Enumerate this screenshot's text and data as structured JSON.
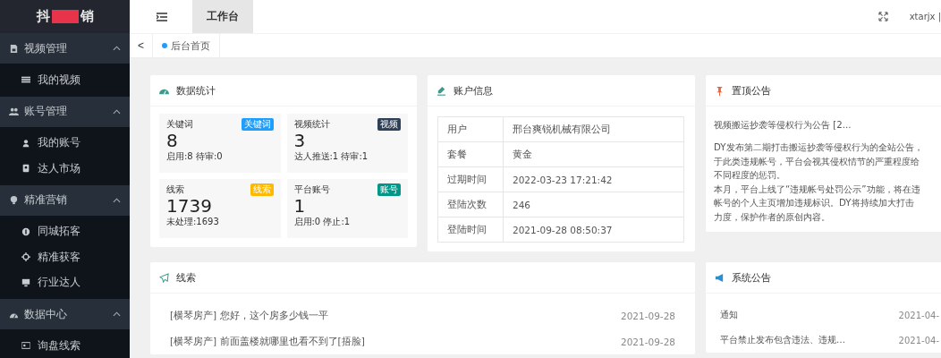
{
  "sidebar": {
    "logo": {
      "left": "抖",
      "right": "销"
    },
    "groups": [
      {
        "label": "视频管理",
        "expanded": true,
        "children": [
          {
            "label": "我的视频"
          }
        ]
      },
      {
        "label": "账号管理",
        "expanded": true,
        "children": [
          {
            "label": "我的账号"
          },
          {
            "label": "达人市场"
          }
        ]
      },
      {
        "label": "精准营销",
        "expanded": true,
        "children": [
          {
            "label": "同城拓客"
          },
          {
            "label": "精准获客"
          },
          {
            "label": "行业达人"
          }
        ]
      },
      {
        "label": "数据中心",
        "expanded": true,
        "children": [
          {
            "label": "询盘线索"
          }
        ]
      }
    ]
  },
  "header": {
    "tabs": [
      {
        "label": "工作台",
        "selected": true
      }
    ],
    "user": "xtarjx |"
  },
  "breadcrumb": {
    "back": "<",
    "items": [
      "后台首页"
    ]
  },
  "stats": {
    "title": "数据统计",
    "tiles": [
      {
        "label": "关键词",
        "badge": "关键词",
        "color": "#1e9fff",
        "value": "8",
        "sub": "启用:8 待审:0"
      },
      {
        "label": "视频统计",
        "badge": "视频",
        "color": "#2f4056",
        "value": "3",
        "sub": "达人推送:1 待审:1"
      },
      {
        "label": "线索",
        "badge": "线索",
        "color": "#ffb800",
        "value": "1739",
        "sub": "未处理:1693"
      },
      {
        "label": "平台账号",
        "badge": "账号",
        "color": "#009688",
        "value": "1",
        "sub": "启用:0 停止:1"
      }
    ]
  },
  "account": {
    "title": "账户信息",
    "rows": [
      {
        "label": "用户",
        "value": "邢台爽锐机械有限公司"
      },
      {
        "label": "套餐",
        "value": "黄金"
      },
      {
        "label": "过期时间",
        "value": "2022-03-23 17:21:42"
      },
      {
        "label": "登陆次数",
        "value": "246"
      },
      {
        "label": "登陆时间",
        "value": "2021-09-28 08:50:37"
      }
    ]
  },
  "pinned": {
    "title": "置顶公告",
    "headline": "视频搬运抄袭等侵权行为公告 [2...",
    "lines": [
      "DY发布第二期打击搬运抄袭等侵权行为的全站公告，",
      "于此类违规帐号，平台会视其侵权情节的严重程度给",
      "不同程度的惩罚。",
      "本月，平台上线了“违规帐号处罚公示”功能，将在违",
      "帐号的个人主页增加违规标识。DY将持续加大打击",
      "力度，保护作者的原创内容。"
    ]
  },
  "leads": {
    "title": "线索",
    "items": [
      {
        "text": "[横琴房产] 您好，这个房多少钱一平",
        "date": "2021-09-28"
      },
      {
        "text": "[横琴房产] 前面盖楼就哪里也看不到了[捂脸]",
        "date": "2021-09-28"
      }
    ]
  },
  "notices": {
    "title": "系统公告",
    "items": [
      {
        "text": "通知",
        "date": "2021-04-"
      },
      {
        "text": "平台禁止发布包含违法、违规…",
        "date": "2021-04-"
      }
    ]
  }
}
